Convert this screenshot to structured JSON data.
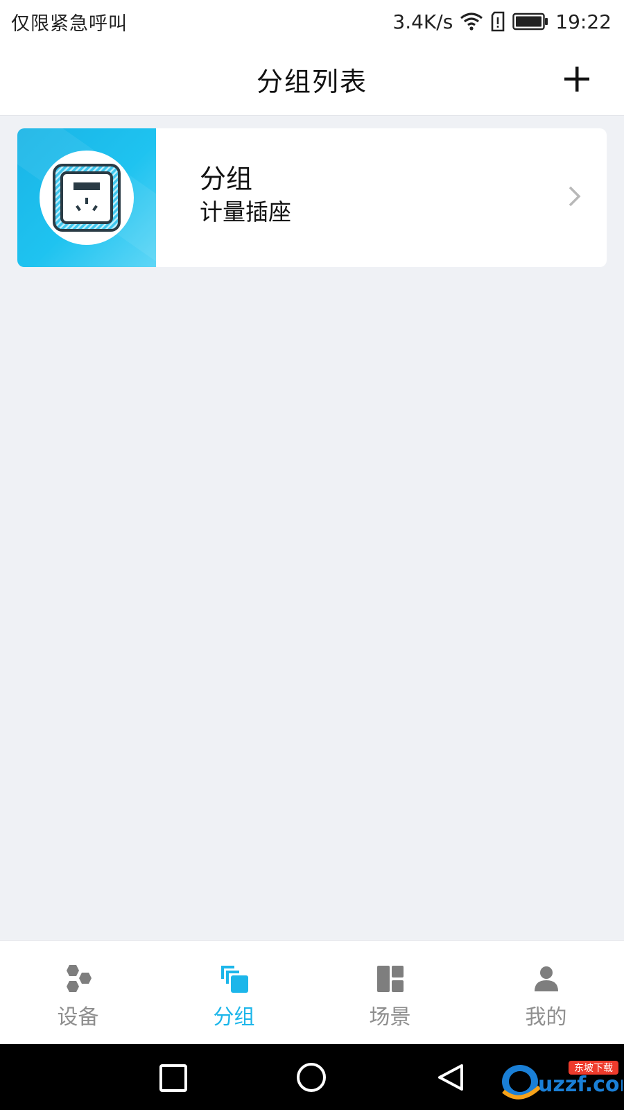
{
  "status_bar": {
    "carrier": "仅限紧急呼叫",
    "speed": "3.4K/s",
    "time": "19:22",
    "icons": [
      "wifi-icon",
      "sim-alert-icon",
      "battery-icon"
    ]
  },
  "header": {
    "title": "分组列表",
    "add_icon": "plus-icon"
  },
  "groups": [
    {
      "title": "分组",
      "subtitle": "计量插座",
      "icon": "smart-socket-icon",
      "chevron": "chevron-right-icon"
    }
  ],
  "bottom_nav": {
    "active": "分组",
    "active_color": "#1cb6ea",
    "items": [
      {
        "label": "设备",
        "icon": "hexagons-icon"
      },
      {
        "label": "分组",
        "icon": "stacked-squares-icon"
      },
      {
        "label": "场景",
        "icon": "layout-icon"
      },
      {
        "label": "我的",
        "icon": "person-icon"
      }
    ]
  },
  "system_nav": [
    "recent-apps-icon",
    "home-icon",
    "back-icon"
  ],
  "colors": {
    "accent": "#1cb6ea",
    "background": "#eff1f5",
    "card_thumb": "#1fc3f0"
  },
  "watermark": {
    "text": "uzzf.com",
    "tag": "东坡下载"
  }
}
